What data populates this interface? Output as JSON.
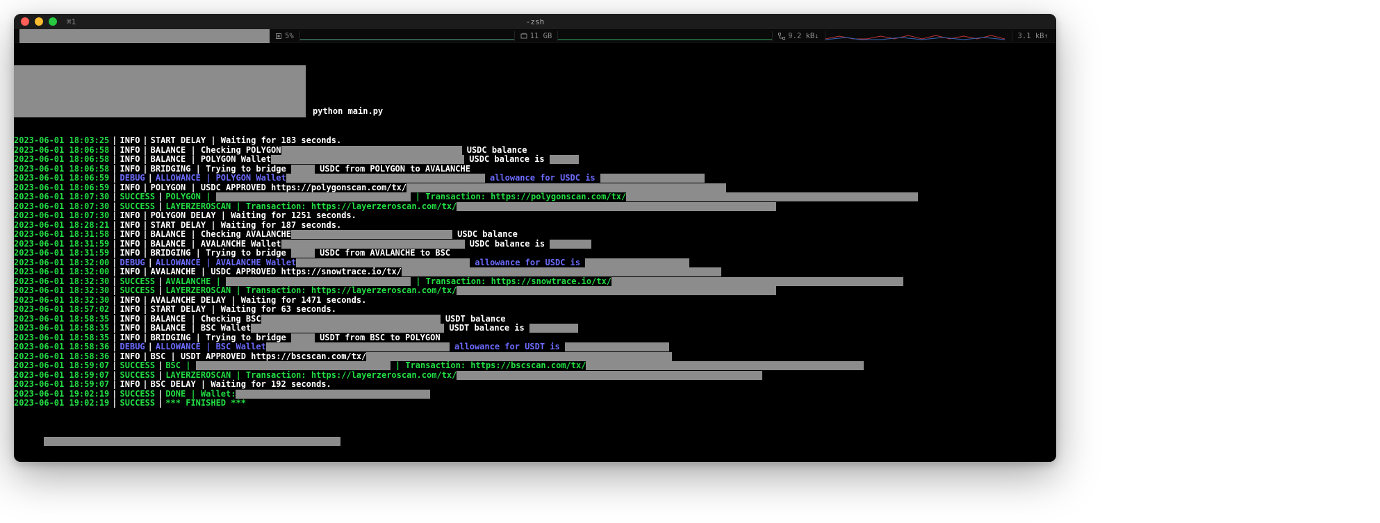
{
  "window": {
    "tab_label": "⌘1",
    "process": "-zsh"
  },
  "statusbar": {
    "cpu_pct": "5%",
    "mem": "11 GB",
    "net_down": "9.2 kB↓",
    "net_up": "3.1 kB↑"
  },
  "command": "python main.py",
  "lines": [
    {
      "ts": "2023-06-01 18:03:25",
      "lvl": "INFO",
      "segs": [
        {
          "t": "START DELAY | Waiting for 183 seconds.",
          "c": "w"
        }
      ]
    },
    {
      "ts": "2023-06-01 18:06:58",
      "lvl": "INFO",
      "segs": [
        {
          "t": "BALANCE | Checking POLYGON",
          "c": "w"
        },
        {
          "r": 260
        },
        {
          "t": " USDC balance",
          "c": "w"
        }
      ]
    },
    {
      "ts": "2023-06-01 18:06:58",
      "lvl": "INFO",
      "segs": [
        {
          "t": "BALANCE | POLYGON Wallet",
          "c": "w"
        },
        {
          "r": 278
        },
        {
          "t": " USDC balance is ",
          "c": "w"
        },
        {
          "r": 42
        }
      ]
    },
    {
      "ts": "2023-06-01 18:06:58",
      "lvl": "INFO",
      "segs": [
        {
          "t": "BRIDGING | Trying to bridge ",
          "c": "w"
        },
        {
          "r": 34
        },
        {
          "t": " USDC from POLYGON to AVALANCHE",
          "c": "w"
        }
      ]
    },
    {
      "ts": "2023-06-01 18:06:59",
      "lvl": "DEBUG",
      "segs": [
        {
          "t": "ALLOWANCE | POLYGON Wallet",
          "c": "b"
        },
        {
          "r": 286
        },
        {
          "t": " allowance for USDC is ",
          "c": "b"
        },
        {
          "r": 150
        }
      ]
    },
    {
      "ts": "2023-06-01 18:06:59",
      "lvl": "INFO",
      "segs": [
        {
          "t": "POLYGON | USDC APPROVED https://polygonscan.com/tx/",
          "c": "w"
        },
        {
          "r": 460
        }
      ]
    },
    {
      "ts": "2023-06-01 18:07:30",
      "lvl": "SUCCESS",
      "segs": [
        {
          "t": "POLYGON | ",
          "c": "g"
        },
        {
          "r": 280
        },
        {
          "t": " | Transaction: https://polygonscan.com/tx/",
          "c": "g"
        },
        {
          "r": 420
        }
      ]
    },
    {
      "ts": "2023-06-01 18:07:30",
      "lvl": "SUCCESS",
      "segs": [
        {
          "t": "LAYERZEROSCAN | Transaction: https://layerzeroscan.com/tx/",
          "c": "g"
        },
        {
          "r": 460
        }
      ]
    },
    {
      "ts": "2023-06-01 18:07:30",
      "lvl": "INFO",
      "segs": [
        {
          "t": "POLYGON DELAY | Waiting for 1251 seconds.",
          "c": "w"
        }
      ]
    },
    {
      "ts": "2023-06-01 18:28:21",
      "lvl": "INFO",
      "segs": [
        {
          "t": "START DELAY | Waiting for 187 seconds.",
          "c": "w"
        }
      ]
    },
    {
      "ts": "2023-06-01 18:31:58",
      "lvl": "INFO",
      "segs": [
        {
          "t": "BALANCE | Checking AVALANCHE",
          "c": "w"
        },
        {
          "r": 232
        },
        {
          "t": " USDC balance",
          "c": "w"
        }
      ]
    },
    {
      "ts": "2023-06-01 18:31:59",
      "lvl": "INFO",
      "segs": [
        {
          "t": "BALANCE | AVALANCHE Wallet",
          "c": "w"
        },
        {
          "r": 264
        },
        {
          "t": " USDC balance is ",
          "c": "w"
        },
        {
          "r": 60
        }
      ]
    },
    {
      "ts": "2023-06-01 18:31:59",
      "lvl": "INFO",
      "segs": [
        {
          "t": "BRIDGING | Trying to bridge ",
          "c": "w"
        },
        {
          "r": 34
        },
        {
          "t": " USDC from AVALANCHE to BSC",
          "c": "w"
        }
      ]
    },
    {
      "ts": "2023-06-01 18:32:00",
      "lvl": "DEBUG",
      "segs": [
        {
          "t": "ALLOWANCE | AVALANCHE Wallet",
          "c": "b"
        },
        {
          "r": 250
        },
        {
          "t": " allowance for USDC is ",
          "c": "b"
        },
        {
          "r": 150
        }
      ]
    },
    {
      "ts": "2023-06-01 18:32:00",
      "lvl": "INFO",
      "segs": [
        {
          "t": "AVALANCHE | USDC APPROVED https://snowtrace.io/tx/",
          "c": "w"
        },
        {
          "r": 460
        }
      ]
    },
    {
      "ts": "2023-06-01 18:32:30",
      "lvl": "SUCCESS",
      "segs": [
        {
          "t": "AVALANCHE | ",
          "c": "g"
        },
        {
          "r": 266
        },
        {
          "t": " | Transaction: https://snowtrace.io/tx/",
          "c": "g"
        },
        {
          "r": 420
        }
      ]
    },
    {
      "ts": "2023-06-01 18:32:30",
      "lvl": "SUCCESS",
      "segs": [
        {
          "t": "LAYERZEROSCAN | Transaction: https://layerzeroscan.com/tx/",
          "c": "g"
        },
        {
          "r": 460
        }
      ]
    },
    {
      "ts": "2023-06-01 18:32:30",
      "lvl": "INFO",
      "segs": [
        {
          "t": "AVALANCHE DELAY | Waiting for 1471 seconds.",
          "c": "w"
        }
      ]
    },
    {
      "ts": "2023-06-01 18:57:02",
      "lvl": "INFO",
      "segs": [
        {
          "t": "START DELAY | Waiting for 63 seconds.",
          "c": "w"
        }
      ]
    },
    {
      "ts": "2023-06-01 18:58:35",
      "lvl": "INFO",
      "segs": [
        {
          "t": "BALANCE | Checking BSC",
          "c": "w"
        },
        {
          "r": 258
        },
        {
          "t": " USDT balance",
          "c": "w"
        }
      ]
    },
    {
      "ts": "2023-06-01 18:58:35",
      "lvl": "INFO",
      "segs": [
        {
          "t": "BALANCE | BSC Wallet",
          "c": "w"
        },
        {
          "r": 278
        },
        {
          "t": " USDT balance is ",
          "c": "w"
        },
        {
          "r": 70
        }
      ]
    },
    {
      "ts": "2023-06-01 18:58:35",
      "lvl": "INFO",
      "segs": [
        {
          "t": "BRIDGING | Trying to bridge ",
          "c": "w"
        },
        {
          "r": 34
        },
        {
          "t": " USDT from BSC to POLYGON",
          "c": "w"
        }
      ]
    },
    {
      "ts": "2023-06-01 18:58:36",
      "lvl": "DEBUG",
      "segs": [
        {
          "t": "ALLOWANCE | BSC Wallet",
          "c": "b"
        },
        {
          "r": 264
        },
        {
          "t": " allowance for USDT is ",
          "c": "b"
        },
        {
          "r": 150
        }
      ]
    },
    {
      "ts": "2023-06-01 18:58:36",
      "lvl": "INFO",
      "segs": [
        {
          "t": "BSC | USDT APPROVED https://bscscan.com/tx/",
          "c": "w"
        },
        {
          "r": 440
        }
      ]
    },
    {
      "ts": "2023-06-01 18:59:07",
      "lvl": "SUCCESS",
      "segs": [
        {
          "t": "BSC | ",
          "c": "g"
        },
        {
          "r": 280
        },
        {
          "t": " | Transaction: https://bscscan.com/tx/",
          "c": "g"
        },
        {
          "r": 400
        }
      ]
    },
    {
      "ts": "2023-06-01 18:59:07",
      "lvl": "SUCCESS",
      "segs": [
        {
          "t": "LAYERZEROSCAN | Transaction: https://layerzeroscan.com/tx/",
          "c": "g"
        },
        {
          "r": 440
        }
      ]
    },
    {
      "ts": "2023-06-01 18:59:07",
      "lvl": "INFO",
      "segs": [
        {
          "t": "BSC DELAY | Waiting for 192 seconds.",
          "c": "w"
        }
      ]
    },
    {
      "ts": "2023-06-01 19:02:19",
      "lvl": "SUCCESS",
      "segs": [
        {
          "t": "DONE | Wallet:",
          "c": "g"
        },
        {
          "r": 280
        }
      ]
    },
    {
      "ts": "2023-06-01 19:02:19",
      "lvl": "SUCCESS",
      "segs": [
        {
          "t": "*** FINISHED ***",
          "c": "g"
        }
      ]
    }
  ]
}
